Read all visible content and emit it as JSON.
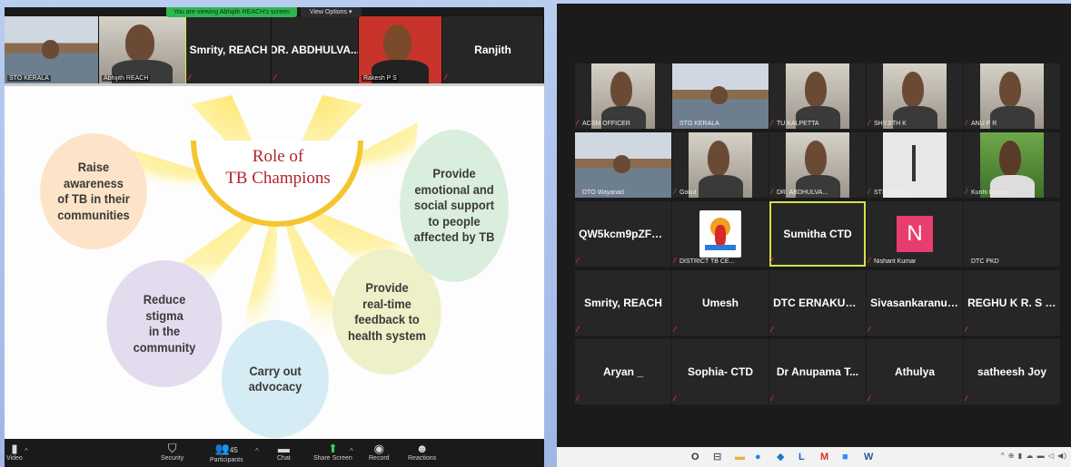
{
  "left": {
    "banner": {
      "text": "You are viewing Abhijith REACH's screen",
      "view_options": "View Options ▾"
    },
    "strip": [
      {
        "kind": "video",
        "label": "STO KERALA",
        "scene": "room"
      },
      {
        "kind": "video",
        "label": "Abhijith REACH",
        "scene": "person",
        "active": true
      },
      {
        "kind": "name",
        "name": "Smrity, REACH"
      },
      {
        "kind": "name",
        "name": "DR. ABDHULVA..."
      },
      {
        "kind": "video",
        "label": "Rakesh P S",
        "scene": "portrait"
      },
      {
        "kind": "name",
        "name": "Ranjith"
      }
    ],
    "slide": {
      "title": "Role of\nTB Champions",
      "bubbles": [
        {
          "key": "raise",
          "text": "Raise\nawareness\nof TB in their\ncommunities",
          "color": "#fde3c7"
        },
        {
          "key": "reduce",
          "text": "Reduce\nstigma\nin the\ncommunity",
          "color": "#e3dcef"
        },
        {
          "key": "advocacy",
          "text": "Carry out\nadvocacy",
          "color": "#d6ecf5"
        },
        {
          "key": "feedback",
          "text": "Provide\nreal-time\nfeedback to\nhealth system",
          "color": "#eef0c8"
        },
        {
          "key": "support",
          "text": "Provide\nemotional and\nsocial support\nto people\naffected by TB",
          "color": "#d9eedd"
        }
      ],
      "accent": "#f7d64a"
    },
    "toolbar": {
      "video": "Video",
      "security": "Security",
      "participants": "Participants",
      "participant_count": "45",
      "chat": "Chat",
      "share_screen": "Share Screen",
      "record": "Record",
      "reactions": "Reactions"
    }
  },
  "right": {
    "gallery": [
      {
        "kind": "video",
        "label": "ACSM OFFICER",
        "scene": "person"
      },
      {
        "kind": "video",
        "label": "STO KERALA",
        "scene": "room"
      },
      {
        "kind": "video",
        "label": "TU KALPETTA",
        "scene": "person"
      },
      {
        "kind": "video",
        "label": "SHYJITH K",
        "scene": "person"
      },
      {
        "kind": "video",
        "label": "ANU P R",
        "scene": "person"
      },
      {
        "kind": "video",
        "label": "DTO Wayanad",
        "scene": "room"
      },
      {
        "kind": "video",
        "label": "Gokul",
        "scene": "person"
      },
      {
        "kind": "video",
        "label": "DR. ABDHULVA...",
        "scene": "person"
      },
      {
        "kind": "video",
        "label": "STS Bathery",
        "scene": "ceiling"
      },
      {
        "kind": "video",
        "label": "Kunhi kannan",
        "scene": "outdoor"
      },
      {
        "kind": "name",
        "name": "QW5kcm9pZFN..."
      },
      {
        "kind": "logo",
        "label": "DISTRICT TB CE..."
      },
      {
        "kind": "name",
        "name": "Sumitha CTD",
        "active": true
      },
      {
        "kind": "avatar",
        "letter": "N",
        "label": "Nishant Kumar"
      },
      {
        "kind": "plain",
        "label": "DTC PKD"
      },
      {
        "kind": "name",
        "name": "Smrity, REACH"
      },
      {
        "kind": "name",
        "name": "Umesh"
      },
      {
        "kind": "name",
        "name": "DTC ERNAKULAM"
      },
      {
        "kind": "name",
        "name": "Sivasankaranuc..."
      },
      {
        "kind": "name",
        "name": "REGHU K R. S T..."
      },
      {
        "kind": "name",
        "name": "Aryan _"
      },
      {
        "kind": "name",
        "name": "Sophia- CTD"
      },
      {
        "kind": "name",
        "name": "Dr Anupama T..."
      },
      {
        "kind": "name",
        "name": "Athulya"
      },
      {
        "kind": "name",
        "name": "satheesh Joy"
      }
    ],
    "taskbar": {
      "icons": [
        {
          "name": "search-icon",
          "glyph": "O",
          "color": "#333"
        },
        {
          "name": "task-view-icon",
          "glyph": "⊟",
          "color": "#555"
        },
        {
          "name": "file-explorer-icon",
          "glyph": "▬",
          "color": "#e8b23a"
        },
        {
          "name": "chrome-icon",
          "glyph": "●",
          "color": "#1e88e5"
        },
        {
          "name": "store-icon",
          "glyph": "◆",
          "color": "#1976d2"
        },
        {
          "name": "app-l-icon",
          "glyph": "L",
          "color": "#1565c0"
        },
        {
          "name": "gmail-icon",
          "glyph": "M",
          "color": "#d93025"
        },
        {
          "name": "zoom-icon",
          "glyph": "■",
          "color": "#2d8cff"
        },
        {
          "name": "word-icon",
          "glyph": "W",
          "color": "#2b579a"
        }
      ],
      "tray": "^ ⊕ ▮ ☁ ▬ ◁ ◀)"
    }
  }
}
